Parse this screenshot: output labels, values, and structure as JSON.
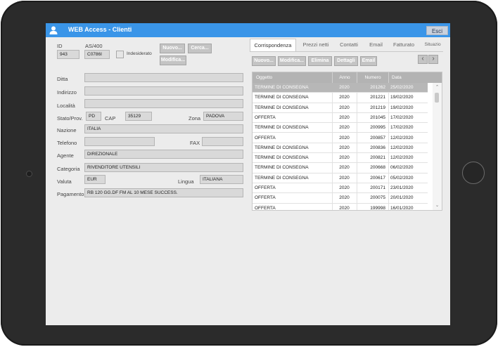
{
  "app": {
    "title": "WEB Access - Clienti",
    "exit_label": "Esci",
    "user_icon": "user-icon"
  },
  "header": {
    "id_label": "ID",
    "id_value": "943",
    "as400_label": "AS/400",
    "as400_value": "C0786I",
    "undesired_label": "Indesiderato",
    "new_label": "Nuovo...",
    "search_label": "Cerca...",
    "edit_label": "Modifica..."
  },
  "form": {
    "ditta_label": "Ditta",
    "ditta_value": "",
    "indirizzo_label": "Indirizzo",
    "indirizzo_value": "",
    "localita_label": "Località",
    "localita_value": "",
    "stato_label": "Stato/Prov.",
    "stato_value": "PD",
    "cap_label": "CAP",
    "cap_value": "35129",
    "zona_label": "Zona",
    "zona_value": "PADOVA",
    "nazione_label": "Nazione",
    "nazione_value": "ITALIA",
    "telefono_label": "Telefono",
    "telefono_value": "",
    "fax_label": "FAX",
    "fax_value": "",
    "agente_label": "Agente",
    "agente_value": "DIREZIONALE",
    "categoria_label": "Categoria",
    "categoria_value": "RIVENDITORE UTENSILI",
    "valuta_label": "Valuta",
    "valuta_value": "EUR",
    "lingua_label": "Lingua",
    "lingua_value": "ITALIANA",
    "pagamento_label": "Pagamento",
    "pagamento_value": "RB 120 GG.DF FM AL 10 MESE SUCCESS."
  },
  "tabs": [
    "Corrispondenza",
    "Prezzi netti",
    "Contatti",
    "Email",
    "Fatturato",
    "Situazio"
  ],
  "actions": {
    "new": "Nuovo...",
    "edit": "Modifica...",
    "delete": "Elimina",
    "details": "Dettagli",
    "email": "Email"
  },
  "grid": {
    "columns": [
      "Oggetto",
      "Anno",
      "Numero",
      "Data"
    ],
    "rows": [
      [
        "TERMINE DI CONSEGNA",
        "2020",
        "201262",
        "25/02/2020"
      ],
      [
        "TERMINE DI CONSEGNA",
        "2020",
        "201221",
        "19/02/2020"
      ],
      [
        "TERMINE DI CONSEGNA",
        "2020",
        "201219",
        "19/02/2020"
      ],
      [
        "OFFERTA",
        "2020",
        "201045",
        "17/02/2020"
      ],
      [
        "TERMINE DI CONSEGNA",
        "2020",
        "200995",
        "17/02/2020"
      ],
      [
        "OFFERTA",
        "2020",
        "200857",
        "12/02/2020"
      ],
      [
        "TERMINE DI CONSEGNA",
        "2020",
        "200836",
        "12/02/2020"
      ],
      [
        "TERMINE DI CONSEGNA",
        "2020",
        "200821",
        "12/02/2020"
      ],
      [
        "TERMINE DI CONSEGNA",
        "2020",
        "200668",
        "06/02/2020"
      ],
      [
        "TERMINE DI CONSEGNA",
        "2020",
        "200617",
        "05/02/2020"
      ],
      [
        "OFFERTA",
        "2020",
        "200171",
        "23/01/2020"
      ],
      [
        "OFFERTA",
        "2020",
        "200075",
        "20/01/2020"
      ],
      [
        "OFFERTA",
        "2020",
        "199998",
        "16/01/2020"
      ]
    ]
  },
  "colors": {
    "titlebar": "#3a95e8",
    "selected_row": "#b7b7b7"
  }
}
